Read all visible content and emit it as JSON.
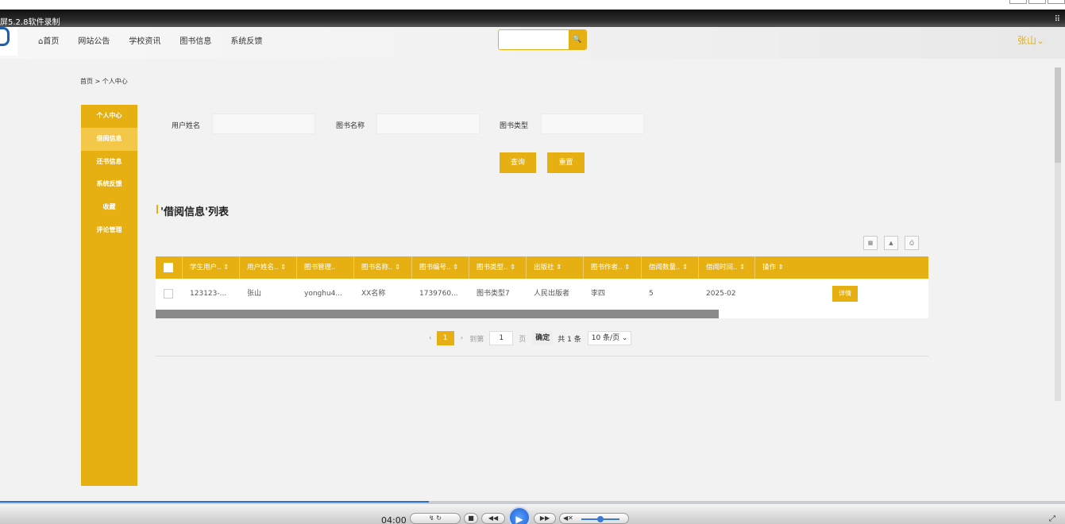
{
  "recorder": {
    "title": "屏5.2.8软件录制",
    "grid_glyph": "⠿",
    "time": "04:00",
    "controls": {
      "a": "↯",
      "b": "↻",
      "stop": "■",
      "rewind": "◀◀",
      "play": "▶",
      "forward": "▶▶",
      "mute": "◀✕",
      "expand": "⤢"
    }
  },
  "header": {
    "nav": [
      "⌂首页",
      "网站公告",
      "学校资讯",
      "图书信息",
      "系统反馈"
    ],
    "search_placeholder": "",
    "search_icon": "🔍",
    "user": "张山⌄"
  },
  "breadcrumb": "首页 > 个人中心",
  "sidebar": {
    "items": [
      {
        "label": "个人中心"
      },
      {
        "label": "借阅信息"
      },
      {
        "label": "还书信息"
      },
      {
        "label": "系统反馈"
      },
      {
        "label": "收藏"
      },
      {
        "label": "评论管理"
      }
    ]
  },
  "filters": {
    "user_name_label": "用户姓名",
    "book_name_label": "图书名称",
    "book_type_label": "图书类型",
    "query_label": "查询",
    "reset_label": "重置"
  },
  "section_title": "'借阅信息'列表",
  "toolbar": {
    "icon1": "▦",
    "icon2": "▲",
    "icon3": "⎙"
  },
  "table": {
    "headers": [
      "学生用户.. ⇕",
      "用户姓名.. ⇕",
      "图书管理..",
      "图书名称.. ⇕",
      "图书编号.. ⇕",
      "图书类型.. ⇕",
      "出版社 ⇕",
      "图书作者.. ⇕",
      "借阅数量.. ⇕",
      "借阅时间.. ⇕",
      "操作 ⇕"
    ],
    "rows": [
      {
        "cells": [
          "123123-...",
          "张山",
          "yonghu4...",
          "XX名称",
          "1739760...",
          "图书类型7",
          "人民出版者",
          "李四",
          "5",
          "2025-02"
        ],
        "action": "详情"
      }
    ]
  },
  "pager": {
    "prev": "‹",
    "page": "1",
    "next": "›",
    "goto_label": "到第",
    "goto_value": "1",
    "page_unit": "页",
    "ok": "确定",
    "total": "共 1 条",
    "page_size": "10 条/页 ⌄"
  }
}
